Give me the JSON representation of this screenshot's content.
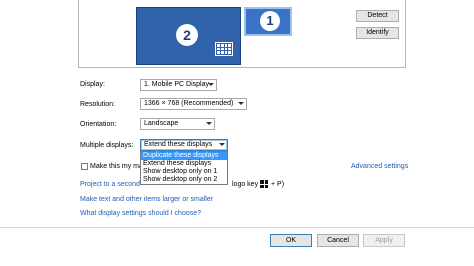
{
  "identify_area": {
    "monitor2_number": "2",
    "monitor1_number": "1",
    "detect_label": "Detect",
    "identify_label": "Identify"
  },
  "settings": {
    "display_label": "Display:",
    "display_value": "1. Mobile PC Display",
    "resolution_label": "Resolution:",
    "resolution_value": "1366 × 768 (Recommended)",
    "orientation_label": "Orientation:",
    "orientation_value": "Landscape",
    "multiple_label": "Multiple displays:",
    "multiple_value": "Extend these displays",
    "multiple_options": [
      "Duplicate these displays",
      "Extend these displays",
      "Show desktop only on 1",
      "Show desktop only on 2"
    ],
    "main_display_text": "Make this my ma",
    "advanced_link": "Advanced settings"
  },
  "links": {
    "project_text": "Project to a second",
    "logo_key_text": "logo key",
    "logo_key_suffix": "+ P)",
    "larger_text": "Make text and other items larger or smaller",
    "choose_text": "What display settings should I choose?"
  },
  "footer": {
    "ok_label": "OK",
    "cancel_label": "Cancel",
    "apply_label": "Apply"
  },
  "colors": {
    "monitor_selected": "#3162ac",
    "monitor_other": "#3a72c4",
    "link": "#1e5fb5",
    "highlight": "#3399ff"
  }
}
